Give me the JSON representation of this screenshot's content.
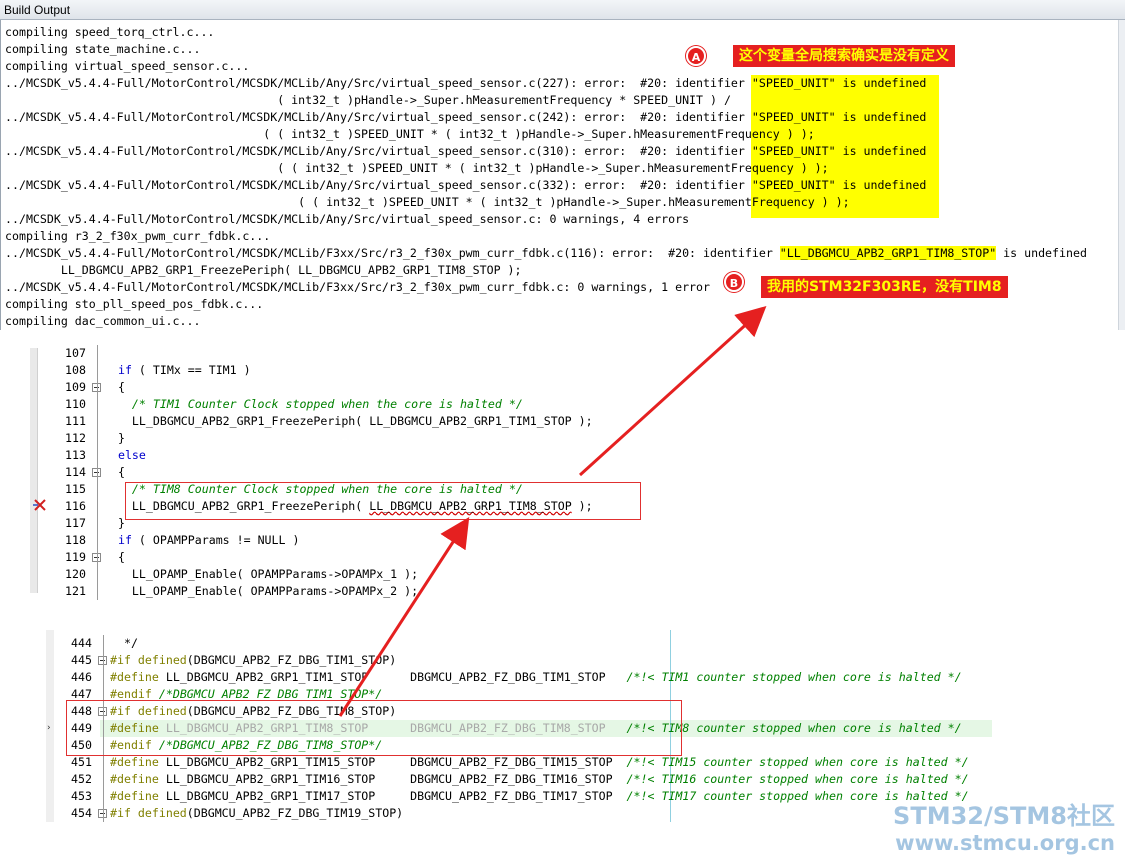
{
  "build_panel": {
    "title": "Build Output",
    "lines": [
      "compiling speed_torq_ctrl.c...",
      "compiling state_machine.c...",
      "compiling virtual_speed_sensor.c...",
      "../MCSDK_v5.4.4-Full/MotorControl/MCSDK/MCLib/Any/Src/virtual_speed_sensor.c(227): error:  #20: identifier ",
      "                                       ( int32_t )pHandle->_Super.hMeasurementFrequency * SPEED_UNIT ) /",
      "../MCSDK_v5.4.4-Full/MotorControl/MCSDK/MCLib/Any/Src/virtual_speed_sensor.c(242): error:  #20: identifier ",
      "                                     ( ( int32_t )SPEED_UNIT * ( int32_t )pHandle->_Super.hMeasurementFrequency ) );",
      "../MCSDK_v5.4.4-Full/MotorControl/MCSDK/MCLib/Any/Src/virtual_speed_sensor.c(310): error:  #20: identifier ",
      "                                       ( ( int32_t )SPEED_UNIT * ( int32_t )pHandle->_Super.hMeasurementFrequency ) );",
      "../MCSDK_v5.4.4-Full/MotorControl/MCSDK/MCLib/Any/Src/virtual_speed_sensor.c(332): error:  #20: identifier ",
      "                                          ( ( int32_t )SPEED_UNIT * ( int32_t )pHandle->_Super.hMeasurementFrequency ) );",
      "../MCSDK_v5.4.4-Full/MotorControl/MCSDK/MCLib/Any/Src/virtual_speed_sensor.c: 0 warnings, 4 errors",
      "compiling r3_2_f30x_pwm_curr_fdbk.c...",
      "../MCSDK_v5.4.4-Full/MotorControl/MCSDK/MCLib/F3xx/Src/r3_2_f30x_pwm_curr_fdbk.c(116): error:  #20: identifier ",
      "        LL_DBGMCU_APB2_GRP1_FreezePeriph( LL_DBGMCU_APB2_GRP1_TIM8_STOP );",
      "../MCSDK_v5.4.4-Full/MotorControl/MCSDK/MCLib/F3xx/Src/r3_2_f30x_pwm_curr_fdbk.c: 0 warnings, 1 error",
      "compiling sto_pll_speed_pos_fdbk.c...",
      "compiling dac_common_ui.c..."
    ],
    "speed_unit_msg": "\"SPEED_UNIT\" is undefined",
    "tim8_id": "\"LL_DBGMCU_APB2_GRP1_TIM8_STOP\"",
    "tim8_suffix": " is undefined"
  },
  "annotations": {
    "badge_a": "A",
    "badge_b": "B",
    "callout_a": "这个变量全局搜索确实是没有定义",
    "callout_b": "我用的STM32F303RE，没有TIM8"
  },
  "editor1": {
    "lines": [
      {
        "num": "107",
        "text": ""
      },
      {
        "num": "108",
        "text": "  if ( TIMx == TIM1 )"
      },
      {
        "num": "109",
        "text": "  {"
      },
      {
        "num": "110",
        "text": "    /* TIM1 Counter Clock stopped when the core is halted */"
      },
      {
        "num": "111",
        "text": "    LL_DBGMCU_APB2_GRP1_FreezePeriph( LL_DBGMCU_APB2_GRP1_TIM1_STOP );"
      },
      {
        "num": "112",
        "text": "  }"
      },
      {
        "num": "113",
        "text": "  else"
      },
      {
        "num": "114",
        "text": "  {"
      },
      {
        "num": "115",
        "text": "    /* TIM8 Counter Clock stopped when the core is halted */"
      },
      {
        "num": "116",
        "text": "    LL_DBGMCU_APB2_GRP1_FreezePeriph( LL_DBGMCU_APB2_GRP1_TIM8_STOP );"
      },
      {
        "num": "117",
        "text": "  }"
      },
      {
        "num": "118",
        "text": "  if ( OPAMPParams != NULL )"
      },
      {
        "num": "119",
        "text": "  {"
      },
      {
        "num": "120",
        "text": "    LL_OPAMP_Enable( OPAMPParams->OPAMPx_1 );"
      },
      {
        "num": "121",
        "text": "    LL_OPAMP_Enable( OPAMPParams->OPAMPx_2 );"
      }
    ]
  },
  "editor2": {
    "lines": [
      {
        "num": "444",
        "text": "  */"
      },
      {
        "num": "445",
        "text": "#if defined(DBGMCU_APB2_FZ_DBG_TIM1_STOP)"
      },
      {
        "num": "446",
        "text": "#define LL_DBGMCU_APB2_GRP1_TIM1_STOP      DBGMCU_APB2_FZ_DBG_TIM1_STOP   /*!< TIM1 counter stopped when core is halted */"
      },
      {
        "num": "447",
        "text": "#endif /*DBGMCU_APB2_FZ_DBG_TIM1_STOP*/"
      },
      {
        "num": "448",
        "text": "#if defined(DBGMCU_APB2_FZ_DBG_TIM8_STOP)"
      },
      {
        "num": "449",
        "text": "#define LL_DBGMCU_APB2_GRP1_TIM8_STOP      DBGMCU_APB2_FZ_DBG_TIM8_STOP   /*!< TIM8 counter stopped when core is halted */"
      },
      {
        "num": "450",
        "text": "#endif /*DBGMCU_APB2_FZ_DBG_TIM8_STOP*/"
      },
      {
        "num": "451",
        "text": "#define LL_DBGMCU_APB2_GRP1_TIM15_STOP     DBGMCU_APB2_FZ_DBG_TIM15_STOP  /*!< TIM15 counter stopped when core is halted */"
      },
      {
        "num": "452",
        "text": "#define LL_DBGMCU_APB2_GRP1_TIM16_STOP     DBGMCU_APB2_FZ_DBG_TIM16_STOP  /*!< TIM16 counter stopped when core is halted */"
      },
      {
        "num": "453",
        "text": "#define LL_DBGMCU_APB2_GRP1_TIM17_STOP     DBGMCU_APB2_FZ_DBG_TIM17_STOP  /*!< TIM17 counter stopped when core is halted */"
      },
      {
        "num": "454",
        "text": "#if defined(DBGMCU_APB2_FZ_DBG_TIM19_STOP)"
      }
    ]
  },
  "watermark": {
    "line1": "STM32/STM8社区",
    "line2": "www.stmcu.org.cn"
  }
}
